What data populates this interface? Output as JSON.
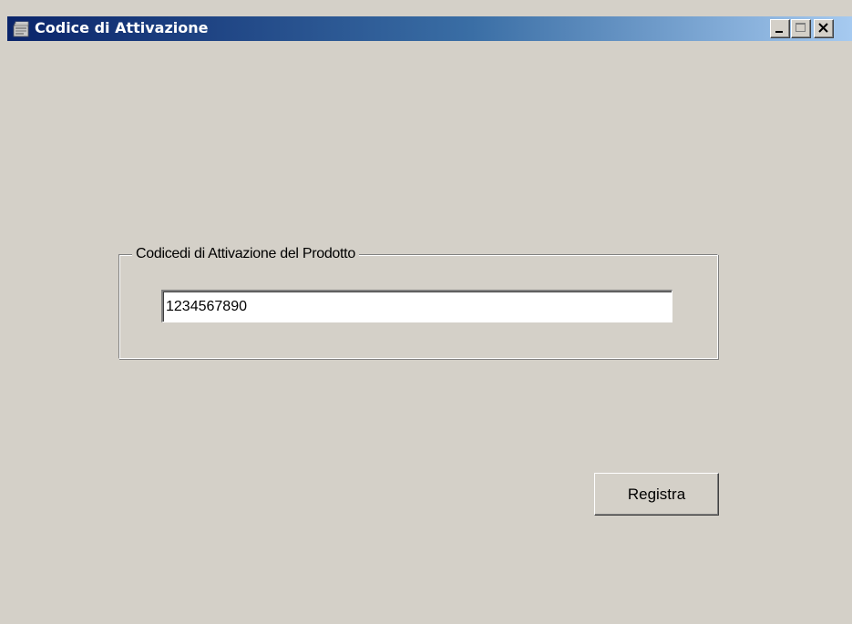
{
  "window": {
    "title": "Codice di Attivazione",
    "icon": "app-icon",
    "controls": {
      "minimize": "minimize-icon",
      "maximize": "maximize-icon",
      "close": "close-icon"
    }
  },
  "group": {
    "legend": "Codicedi di Attivazione del  Prodotto"
  },
  "activation": {
    "value": "1234567890"
  },
  "buttons": {
    "register_label": "Registra"
  },
  "colors": {
    "face": "#d4d0c8",
    "title_start": "#0a246a",
    "title_end": "#a6caf0"
  }
}
